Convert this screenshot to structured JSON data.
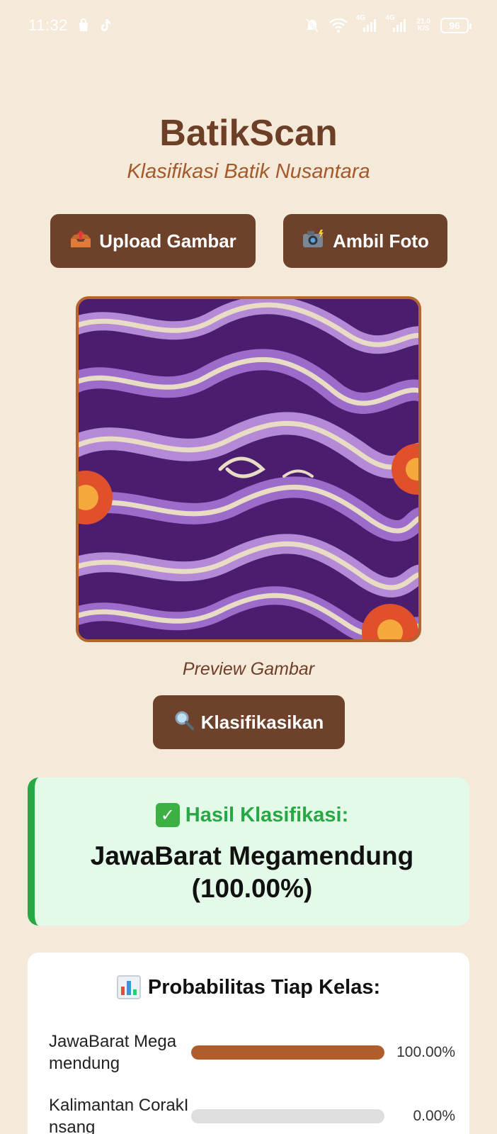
{
  "status_bar": {
    "time": "11:32",
    "network_1": "4G",
    "network_2": "4G",
    "speed_value": "21.0",
    "speed_unit": "K/S",
    "battery": "96"
  },
  "header": {
    "title": "BatikScan",
    "subtitle": "Klasifikasi Batik Nusantara"
  },
  "actions": {
    "upload_label": "Upload Gambar",
    "upload_icon": "outbox-tray-icon",
    "camera_label": "Ambil Foto",
    "camera_icon": "camera-flash-icon"
  },
  "preview": {
    "caption": "Preview Gambar"
  },
  "classify": {
    "label": "Klasifikasikan",
    "icon": "magnifier-icon"
  },
  "result": {
    "heading": "Hasil Klasifikasi:",
    "value": "JawaBarat Megamendung (100.00%)",
    "accent_color": "#28a745"
  },
  "probabilities": {
    "heading": "Probabilitas Tiap Kelas:",
    "items": [
      {
        "label": "JawaBarat Megamendung",
        "value": "100.00%",
        "fraction": 1.0
      },
      {
        "label": "Kalimantan CorakInsang",
        "value": "0.00%",
        "fraction": 0.0
      }
    ]
  },
  "colors": {
    "background": "#f5e9da",
    "brand_brown": "#6e412a",
    "bar_fill": "#b05c2b"
  }
}
